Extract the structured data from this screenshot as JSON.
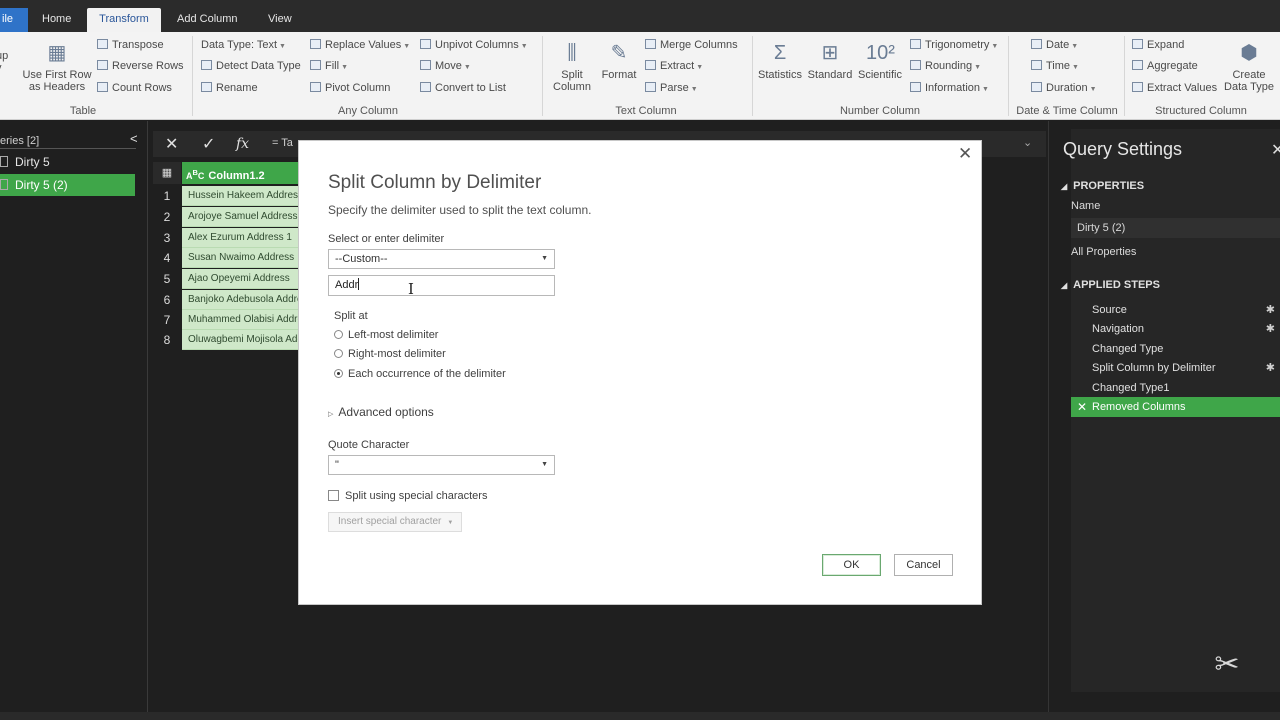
{
  "ribbon": {
    "tabs": {
      "file": "ile",
      "home": "Home",
      "transform": "Transform",
      "add_column": "Add Column",
      "view": "View"
    },
    "table_group": {
      "group_by_partial": "up\ny",
      "use_first_row": "Use First Row\nas Headers",
      "transpose": "Transpose",
      "reverse_rows": "Reverse Rows",
      "count_rows": "Count Rows",
      "label": "Table"
    },
    "any_column": {
      "data_type": "Data Type: Text",
      "detect_data_type": "Detect Data Type",
      "rename": "Rename",
      "replace_values": "Replace Values",
      "fill": "Fill",
      "pivot_column": "Pivot Column",
      "unpivot_columns": "Unpivot Columns",
      "move": "Move",
      "convert_to_list": "Convert to List",
      "label": "Any Column"
    },
    "text_column": {
      "split_column": "Split\nColumn",
      "format": "Format",
      "merge_columns": "Merge Columns",
      "extract": "Extract",
      "parse": "Parse",
      "label": "Text Column"
    },
    "number_column": {
      "statistics": "Statistics",
      "standard": "Standard",
      "scientific": "Scientific",
      "trigonometry": "Trigonometry",
      "rounding": "Rounding",
      "information": "Information",
      "label": "Number Column"
    },
    "datetime_column": {
      "date": "Date",
      "time": "Time",
      "duration": "Duration",
      "label": "Date & Time Column"
    },
    "structured_column": {
      "expand": "Expand",
      "aggregate": "Aggregate",
      "extract_values": "Extract Values",
      "create_data_type": "Create\nData Type",
      "label": "Structured Column"
    }
  },
  "queries": {
    "header": "eries [2]",
    "items": [
      {
        "label": "Dirty 5",
        "selected": false
      },
      {
        "label": "Dirty 5 (2)",
        "selected": true
      }
    ]
  },
  "formula_bar": {
    "cancel": "✕",
    "confirm": "✓",
    "fx": "fx",
    "text": "= Ta"
  },
  "grid": {
    "column_header": "Column1.2",
    "rows": [
      {
        "num": "1",
        "value": "Hussein Hakeem Address"
      },
      {
        "num": "2",
        "value": "Arojoye Samuel Address"
      },
      {
        "num": "3",
        "value": "Alex Ezurum Address 1"
      },
      {
        "num": "4",
        "value": "Susan Nwaimo Address"
      },
      {
        "num": "5",
        "value": "Ajao Opeyemi Address"
      },
      {
        "num": "6",
        "value": "Banjoko Adebusola Address"
      },
      {
        "num": "7",
        "value": "Muhammed Olabisi Address"
      },
      {
        "num": "8",
        "value": "Oluwagbemi Mojisola Address"
      }
    ]
  },
  "query_settings": {
    "title": "Query Settings",
    "properties_header": "PROPERTIES",
    "name_label": "Name",
    "name_value": "Dirty 5 (2)",
    "all_properties": "All Properties",
    "applied_steps_header": "APPLIED STEPS",
    "steps": [
      {
        "label": "Source",
        "gear": true,
        "selected": false
      },
      {
        "label": "Navigation",
        "gear": true,
        "selected": false
      },
      {
        "label": "Changed Type",
        "gear": false,
        "selected": false
      },
      {
        "label": "Split Column by Delimiter",
        "gear": true,
        "selected": false
      },
      {
        "label": "Changed Type1",
        "gear": false,
        "selected": false
      },
      {
        "label": "Removed Columns",
        "gear": false,
        "selected": true
      }
    ]
  },
  "dialog": {
    "title": "Split Column by Delimiter",
    "subtitle": "Specify the delimiter used to split the text column.",
    "delimiter_label": "Select or enter delimiter",
    "delimiter_value": "--Custom--",
    "custom_input_value": "Addr",
    "split_at_label": "Split at",
    "split_options": [
      {
        "label": "Left-most delimiter",
        "checked": false
      },
      {
        "label": "Right-most delimiter",
        "checked": false
      },
      {
        "label": "Each occurrence of the delimiter",
        "checked": true
      }
    ],
    "advanced_options": "Advanced options",
    "quote_char_label": "Quote Character",
    "quote_char_value": "\"",
    "special_chars_label": "Split using special characters",
    "insert_special_char": "Insert special character",
    "ok": "OK",
    "cancel": "Cancel"
  },
  "colors": {
    "accent_green": "#3fa649",
    "grid_cell": "#cfe8c9",
    "ribbon_bg": "#f3f3f3",
    "dark_bg": "#1f1f1f"
  }
}
